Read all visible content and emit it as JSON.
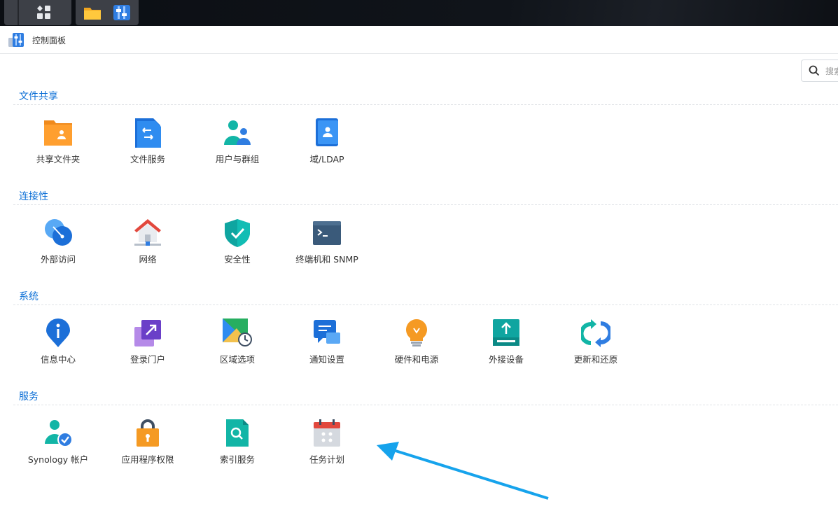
{
  "window": {
    "title": "控制面板"
  },
  "search": {
    "placeholder": "搜索"
  },
  "sections": [
    {
      "title": "文件共享",
      "items": [
        {
          "label": "共享文件夹",
          "icon": "shared-folder-icon"
        },
        {
          "label": "文件服务",
          "icon": "file-services-icon"
        },
        {
          "label": "用户与群组",
          "icon": "user-group-icon"
        },
        {
          "label": "域/LDAP",
          "icon": "domain-ldap-icon"
        }
      ]
    },
    {
      "title": "连接性",
      "items": [
        {
          "label": "外部访问",
          "icon": "external-access-icon"
        },
        {
          "label": "网络",
          "icon": "network-icon"
        },
        {
          "label": "安全性",
          "icon": "security-shield-icon"
        },
        {
          "label": "终端机和 SNMP",
          "icon": "terminal-icon"
        }
      ]
    },
    {
      "title": "系统",
      "items": [
        {
          "label": "信息中心",
          "icon": "info-center-icon"
        },
        {
          "label": "登录门户",
          "icon": "login-portal-icon"
        },
        {
          "label": "区域选项",
          "icon": "regional-options-icon"
        },
        {
          "label": "通知设置",
          "icon": "notification-icon"
        },
        {
          "label": "硬件和电源",
          "icon": "hardware-power-icon"
        },
        {
          "label": "外接设备",
          "icon": "external-devices-icon"
        },
        {
          "label": "更新和还原",
          "icon": "update-restore-icon"
        }
      ]
    },
    {
      "title": "服务",
      "items": [
        {
          "label": "Synology 帐户",
          "icon": "synology-account-icon"
        },
        {
          "label": "应用程序权限",
          "icon": "app-privileges-icon"
        },
        {
          "label": "索引服务",
          "icon": "indexing-service-icon"
        },
        {
          "label": "任务计划",
          "icon": "task-scheduler-icon"
        }
      ]
    }
  ],
  "colors": {
    "section_title": "#0c6fd6",
    "annotation_arrow": "#16a3ec"
  }
}
